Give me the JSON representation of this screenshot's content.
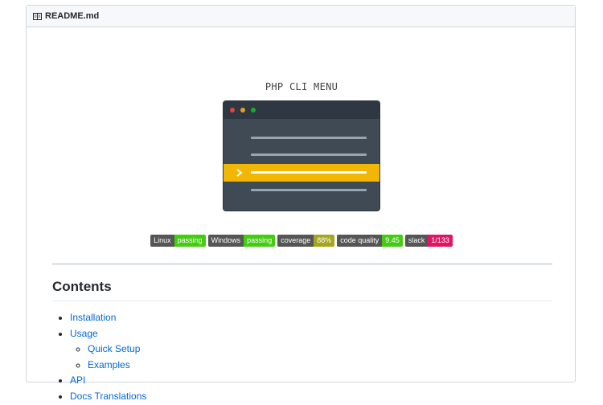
{
  "header": {
    "filename": "README.md",
    "icon": "book-icon"
  },
  "banner": {
    "title": "PHP CLI MENU",
    "colors": {
      "window": "#3f4a55",
      "titlebar": "#2f3842",
      "highlight": "#f2b705",
      "dot_red": "#e0443e",
      "dot_yellow": "#dea123",
      "dot_green": "#1aab29"
    }
  },
  "badges": [
    {
      "label": "Linux",
      "value": "passing",
      "color": "#4c1"
    },
    {
      "label": "Windows",
      "value": "passing",
      "color": "#4c1"
    },
    {
      "label": "coverage",
      "value": "88%",
      "color": "#a4a61d"
    },
    {
      "label": "code quality",
      "value": "9.45",
      "color": "#4c1"
    },
    {
      "label": "slack",
      "value": "1/133",
      "color": "#e01563"
    }
  ],
  "contents": {
    "heading": "Contents",
    "items": [
      {
        "label": "Installation"
      },
      {
        "label": "Usage",
        "children": [
          {
            "label": "Quick Setup"
          },
          {
            "label": "Examples"
          }
        ]
      },
      {
        "label": "API"
      },
      {
        "label": "Docs Translations"
      }
    ]
  }
}
